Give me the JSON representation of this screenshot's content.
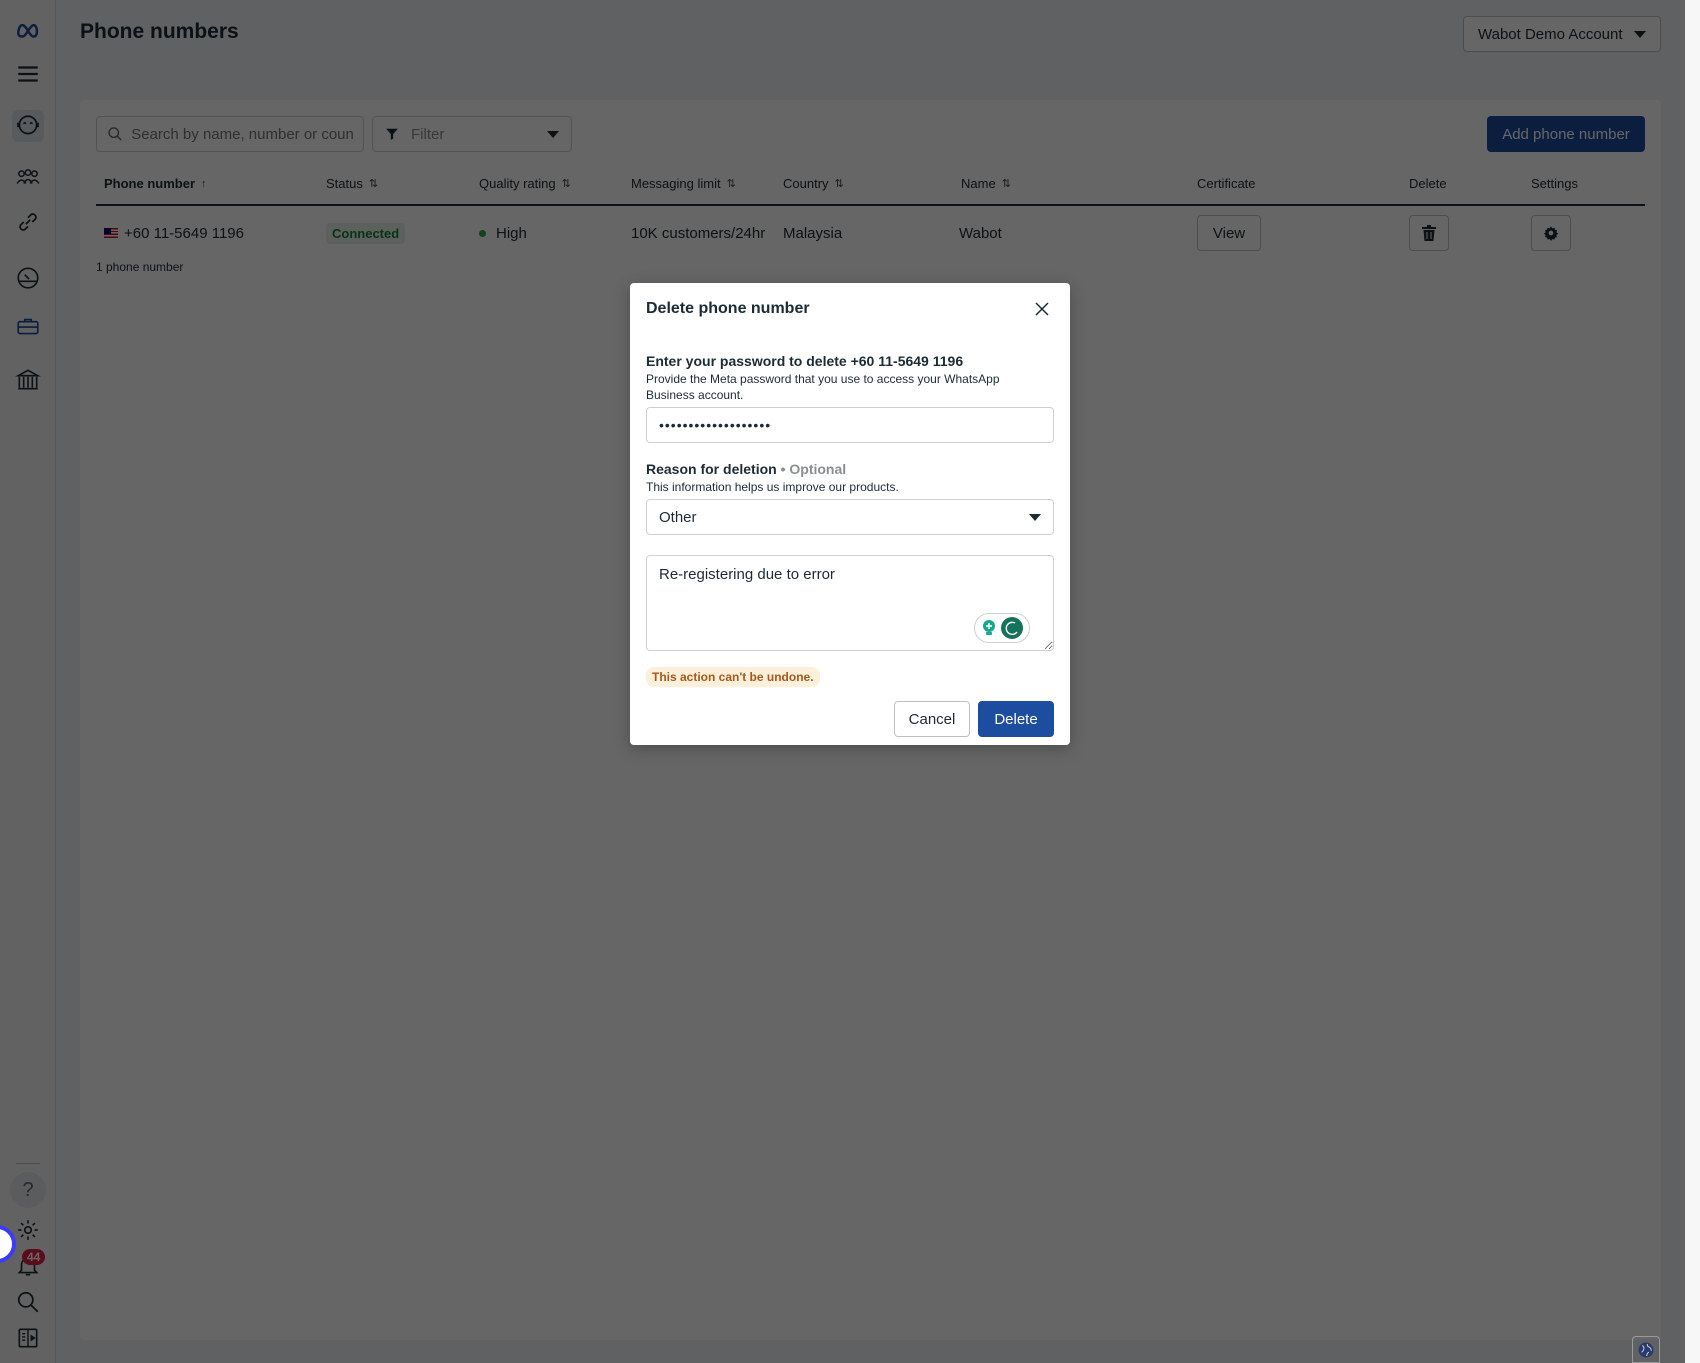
{
  "header": {
    "title": "Phone numbers",
    "account": "Wabot Demo Account"
  },
  "toolbar": {
    "search_placeholder": "Search by name, number or country",
    "filter_label": "Filter",
    "add_button": "Add phone number"
  },
  "table": {
    "columns": [
      {
        "label": "Phone number",
        "sort": "ascending"
      },
      {
        "label": "Status",
        "sort": "sortable"
      },
      {
        "label": "Quality rating",
        "sort": "sortable"
      },
      {
        "label": "Messaging limit",
        "sort": "sortable"
      },
      {
        "label": "Country",
        "sort": "sortable"
      },
      {
        "label": "Name",
        "sort": "sortable"
      },
      {
        "label": "Certificate"
      },
      {
        "label": "Delete"
      },
      {
        "label": "Settings"
      }
    ],
    "rows": [
      {
        "flag": "Malaysia flag",
        "phone": "+60 11-5649 1196",
        "status": "Connected",
        "quality": "High",
        "messaging_limit": "10K customers/24hr",
        "country": "Malaysia",
        "name": "Wabot",
        "certificate_button": "View"
      }
    ],
    "count_text": "1 phone number"
  },
  "sidebar": {
    "icons": [
      "meta-logo",
      "menu",
      "whatsapp-support",
      "people",
      "link",
      "dashboard-gauge",
      "briefcase",
      "bank"
    ],
    "bottom_icons": [
      "help",
      "settings",
      "notifications",
      "search",
      "panel-toggle"
    ],
    "notification_count": "44",
    "help_glyph": "?"
  },
  "modal": {
    "title": "Delete phone number",
    "password_label": "Enter your password to delete +60 11-5649 1196",
    "password_help": "Provide the Meta password that you use to access your WhatsApp Business account.",
    "password_value": "•••••••••••••••••••",
    "reason_label": "Reason for deletion",
    "reason_separator": "•",
    "reason_optional": "Optional",
    "reason_help": "This information helps us improve our products.",
    "reason_selected": "Other",
    "reason_text": "Re-registering due to error",
    "warning": "This action can't be undone.",
    "cancel_label": "Cancel",
    "delete_label": "Delete"
  },
  "colors": {
    "primary": "#1d4d9e",
    "connected": "#1e7d32",
    "warning_text": "#a5591b",
    "warning_bg": "#fdf0db",
    "badge_red": "#e41e3f"
  }
}
